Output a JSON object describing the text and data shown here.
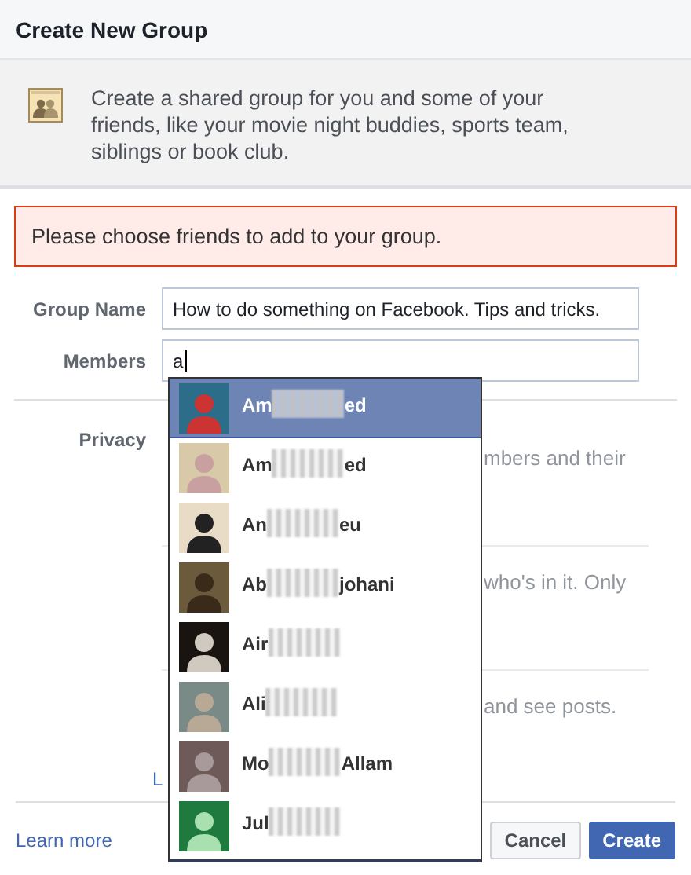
{
  "dialog": {
    "title": "Create New Group"
  },
  "intro": {
    "text": "Create a shared group for you and some of your friends, like your movie night buddies, sports team, siblings or book club."
  },
  "error": {
    "text": "Please choose friends to add to your group."
  },
  "form": {
    "group_name": {
      "label": "Group Name",
      "value": "How to do something on Facebook. Tips and tricks."
    },
    "members": {
      "label": "Members",
      "value": "a"
    }
  },
  "privacy": {
    "label": "Privacy",
    "options": [
      {
        "text": "mbers and their"
      },
      {
        "text": "who's in it. Only"
      },
      {
        "text": "and see posts."
      }
    ],
    "link": "L"
  },
  "suggestions": [
    {
      "name_start": "Am",
      "name_end": "ed",
      "selected": true
    },
    {
      "name_start": "Am",
      "name_end": "ed",
      "selected": false
    },
    {
      "name_start": "An",
      "name_end": "eu",
      "selected": false
    },
    {
      "name_start": "Ab",
      "name_end": "johani",
      "selected": false
    },
    {
      "name_start": "Air",
      "selected": false
    },
    {
      "name_start": "Ali",
      "selected": false
    },
    {
      "name_start": "Mo",
      "name_end": "Allam",
      "selected": false
    },
    {
      "name_start": "Jul",
      "selected": false
    }
  ],
  "footer": {
    "link": "Learn more",
    "buttons": [
      {
        "label": "Cancel",
        "kind": "secondary"
      },
      {
        "label": "Create",
        "kind": "primary"
      }
    ]
  }
}
